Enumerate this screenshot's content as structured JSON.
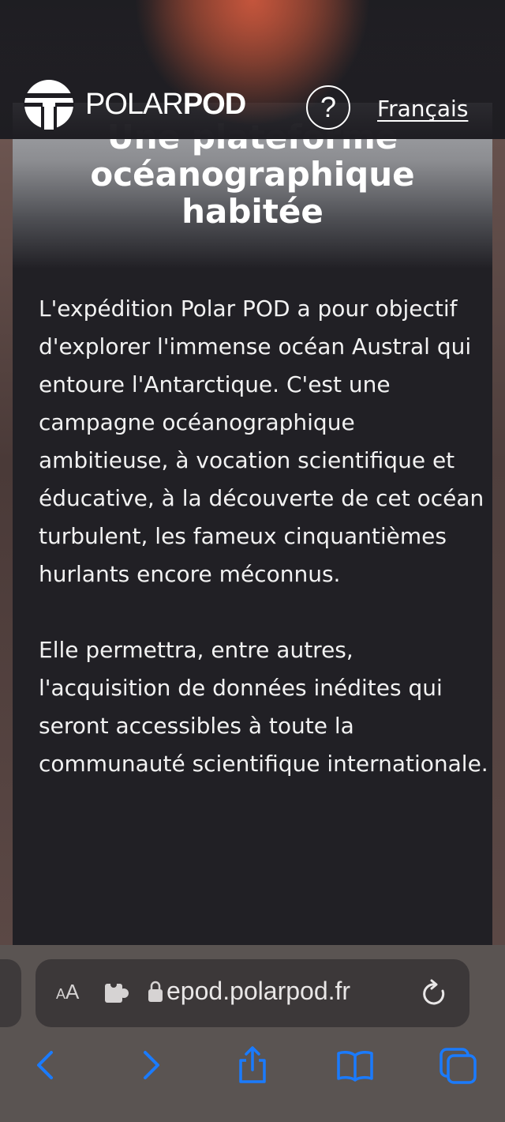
{
  "header": {
    "brand_light": "POLAR",
    "brand_bold": "POD",
    "help_glyph": "?",
    "language_link": "Français"
  },
  "article": {
    "title_line1": "Une plateforme",
    "title_line2": "océanographique",
    "title_line3": "habitée",
    "paragraphs": [
      "L'expédition Polar POD a pour objectif d'explorer l'immense océan Austral qui entoure l'Antarctique. C'est une campagne océanographique ambitieuse, à vocation scientifique et éducative, à la découverte de cet océan turbulent, les fameux cinquantièmes hurlants encore méconnus.",
      "Elle permettra, entre autres, l'acquisition de données inédites qui seront accessibles à toute la communauté scientifique internationale."
    ]
  },
  "browser": {
    "aa_small": "A",
    "aa_big": "A",
    "url": "epod.polarpod.fr",
    "icons": {
      "extension": "puzzle-icon",
      "lock": "lock-icon",
      "reload": "reload-icon",
      "back": "chevron-left-icon",
      "forward": "chevron-right-icon",
      "share": "share-icon",
      "bookmarks": "book-icon",
      "tabs": "tabs-icon"
    },
    "accent_color": "#1a7bff"
  }
}
